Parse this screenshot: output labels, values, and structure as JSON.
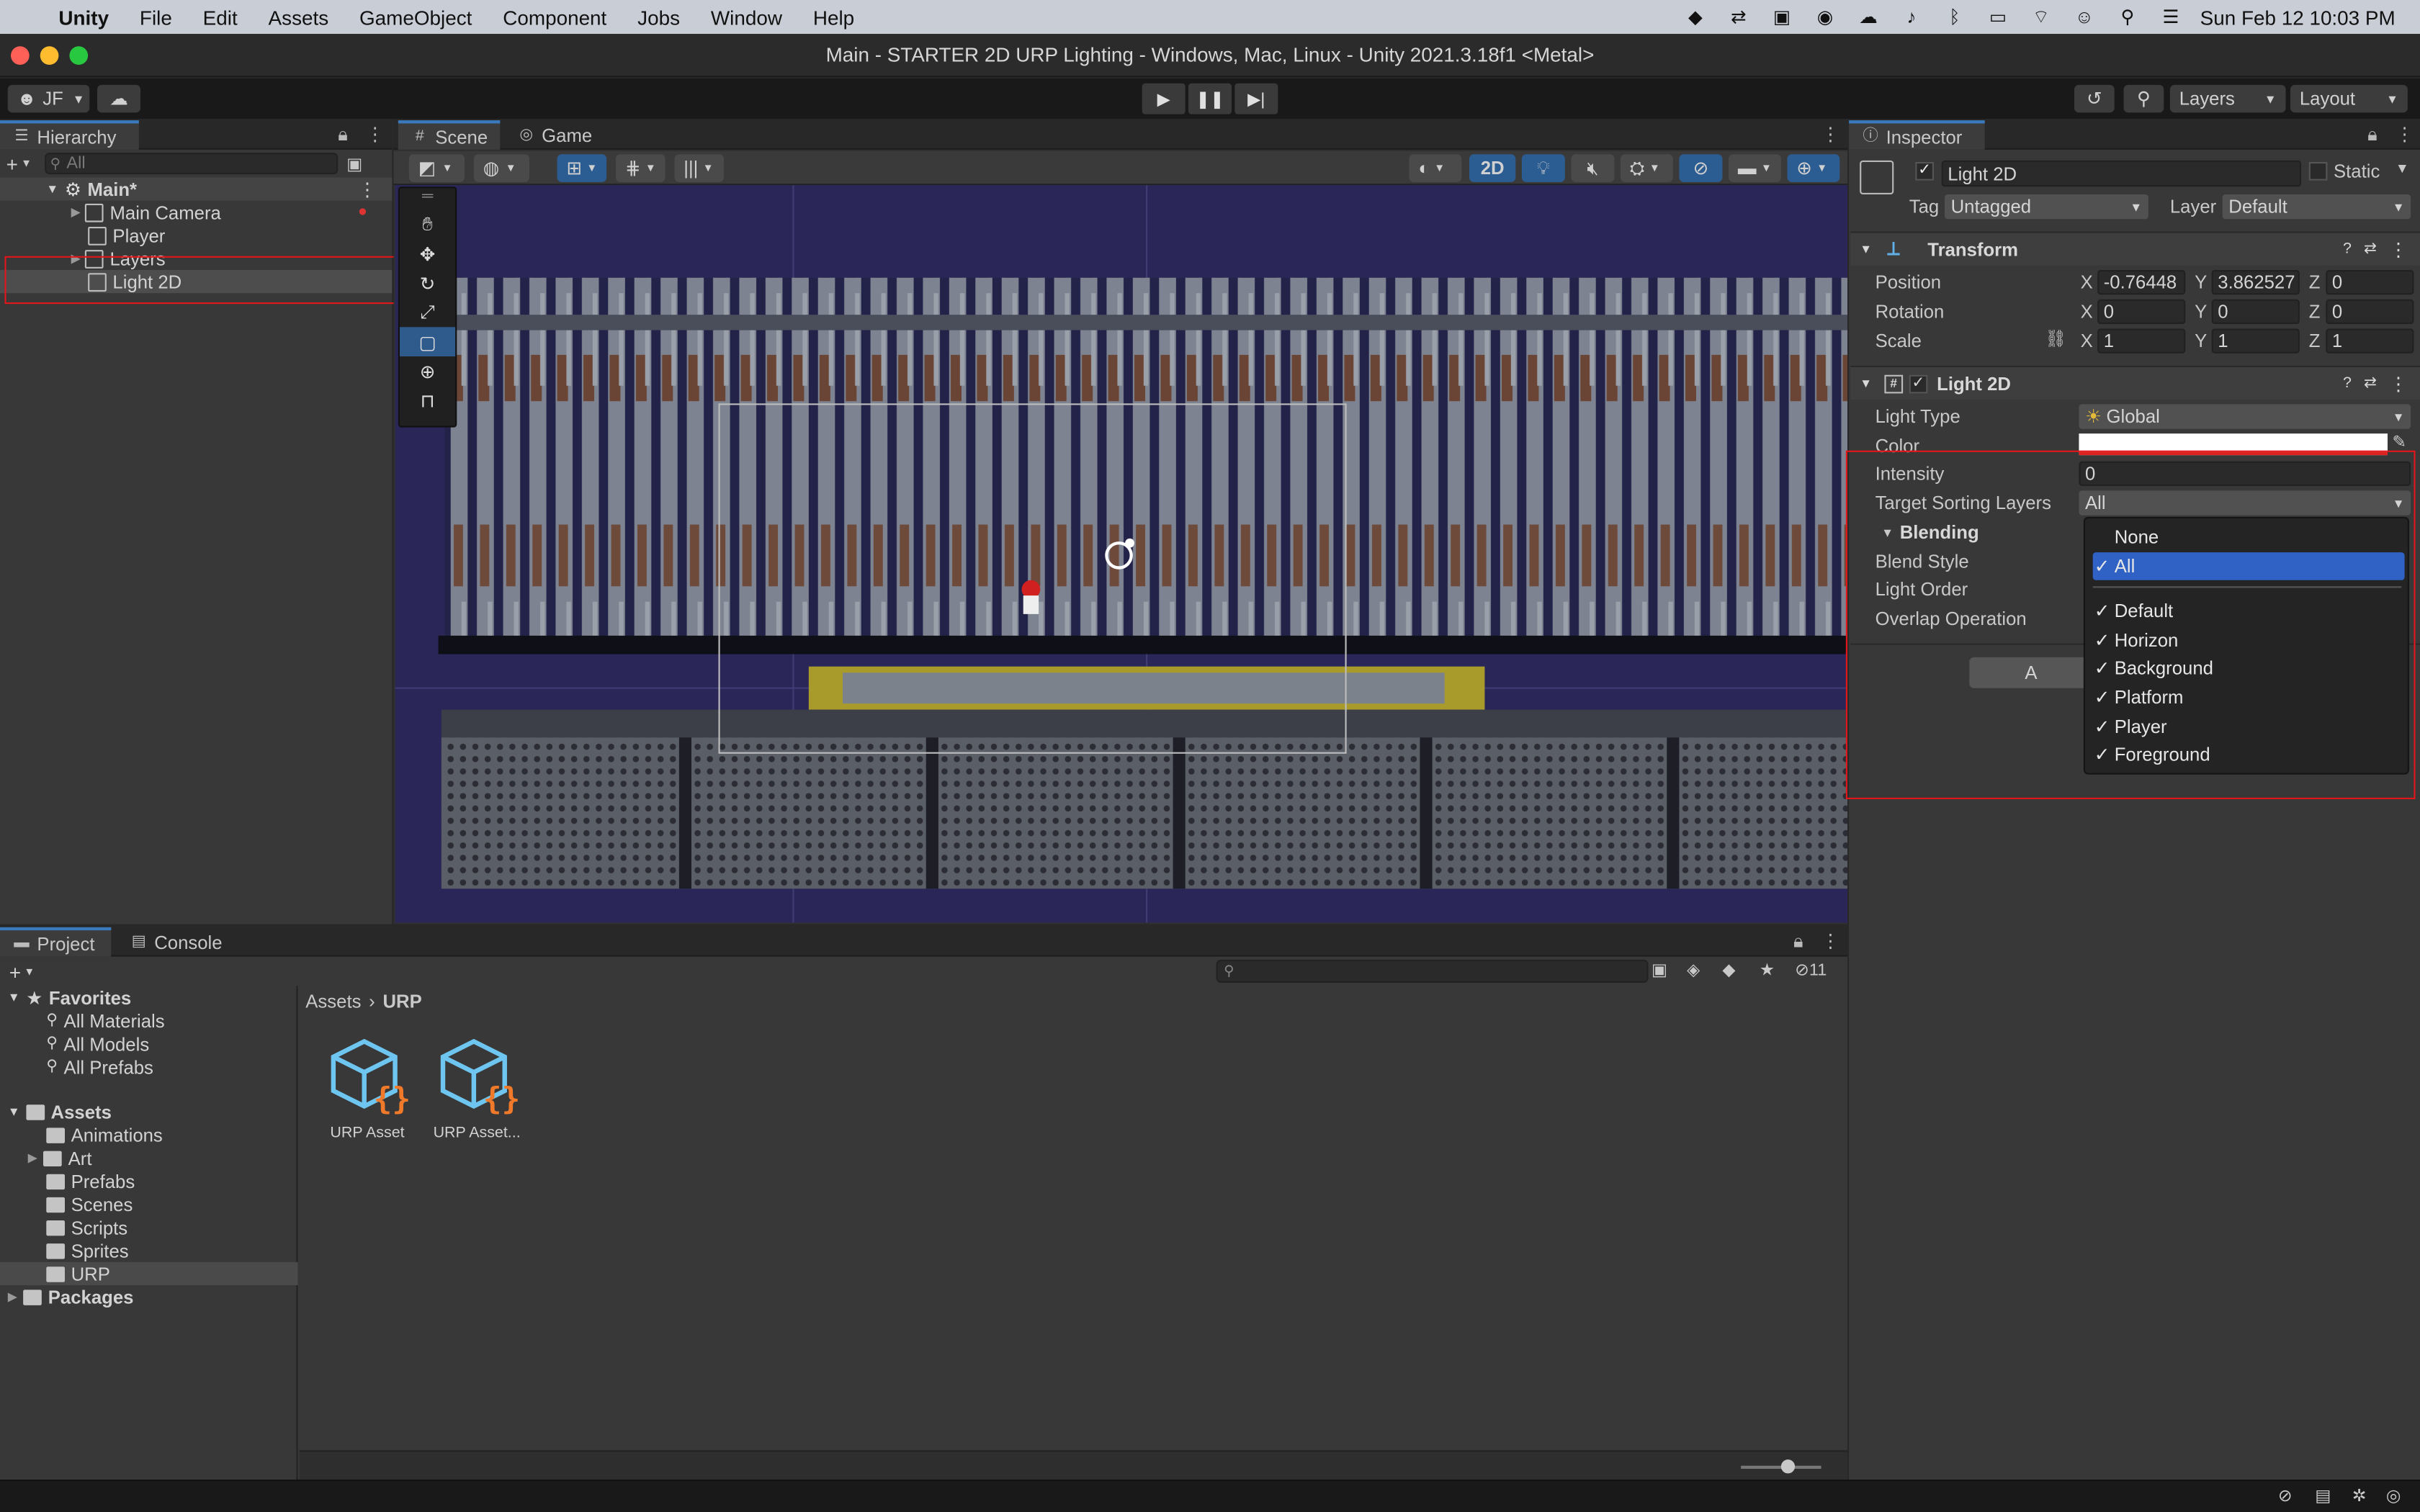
{
  "menubar": {
    "app_name": "Unity",
    "items": [
      "File",
      "Edit",
      "Assets",
      "GameObject",
      "Component",
      "Jobs",
      "Window",
      "Help"
    ],
    "clock": "Sun Feb 12  10:03 PM"
  },
  "window": {
    "title": "Main - STARTER 2D URP Lighting - Windows, Mac, Linux - Unity 2021.3.18f1 <Metal>"
  },
  "toolbar": {
    "account": "JF",
    "layers_label": "Layers",
    "layout_label": "Layout"
  },
  "hierarchy": {
    "tab_label": "Hierarchy",
    "search_placeholder": "All",
    "scene": "Main*",
    "items": [
      "Main Camera",
      "Player",
      "Layers",
      "Light 2D"
    ]
  },
  "scene": {
    "tabs": [
      "Scene",
      "Game"
    ],
    "mode_2d": "2D"
  },
  "inspector": {
    "tab_label": "Inspector",
    "object_name": "Light 2D",
    "static_label": "Static",
    "tag_label": "Tag",
    "tag_value": "Untagged",
    "layer_label": "Layer",
    "layer_value": "Default",
    "transform": {
      "title": "Transform",
      "position_label": "Position",
      "rotation_label": "Rotation",
      "scale_label": "Scale",
      "position": {
        "x": "-0.76448",
        "y": "3.862527",
        "z": "0"
      },
      "rotation": {
        "x": "0",
        "y": "0",
        "z": "0"
      },
      "scale": {
        "x": "1",
        "y": "1",
        "z": "1"
      }
    },
    "light2d": {
      "title": "Light 2D",
      "light_type_label": "Light Type",
      "light_type_value": "Global",
      "color_label": "Color",
      "color_value": "#ffffff",
      "intensity_label": "Intensity",
      "intensity_value": "0",
      "target_sorting_label": "Target Sorting Layers",
      "target_sorting_value": "All",
      "blending_label": "Blending",
      "blend_style_label": "Blend Style",
      "light_order_label": "Light Order",
      "overlap_label": "Overlap Operation",
      "add_button_partial": "A"
    }
  },
  "sorting_popup": {
    "options": [
      {
        "label": "None",
        "checked": false,
        "selected": false
      },
      {
        "label": "All",
        "checked": true,
        "selected": true
      },
      {
        "label": "Default",
        "checked": true,
        "selected": false
      },
      {
        "label": "Horizon",
        "checked": true,
        "selected": false
      },
      {
        "label": "Background",
        "checked": true,
        "selected": false
      },
      {
        "label": "Platform",
        "checked": true,
        "selected": false
      },
      {
        "label": "Player",
        "checked": true,
        "selected": false
      },
      {
        "label": "Foreground",
        "checked": true,
        "selected": false
      }
    ],
    "check_glyph": "✓"
  },
  "project": {
    "tabs": [
      "Project",
      "Console"
    ],
    "hidden_count": "11",
    "favorites_label": "Favorites",
    "favorites": [
      "All Materials",
      "All Models",
      "All Prefabs"
    ],
    "assets_label": "Assets",
    "asset_folders": [
      "Animations",
      "Art",
      "Prefabs",
      "Scenes",
      "Scripts",
      "Sprites",
      "URP"
    ],
    "packages_label": "Packages",
    "breadcrumb_root": "Assets",
    "breadcrumb_current": "URP",
    "files": [
      "URP Asset",
      "URP Asset..."
    ]
  },
  "colors": {
    "accent": "#2f62c4",
    "highlight_box": "#e0161b",
    "panel": "#383838"
  }
}
